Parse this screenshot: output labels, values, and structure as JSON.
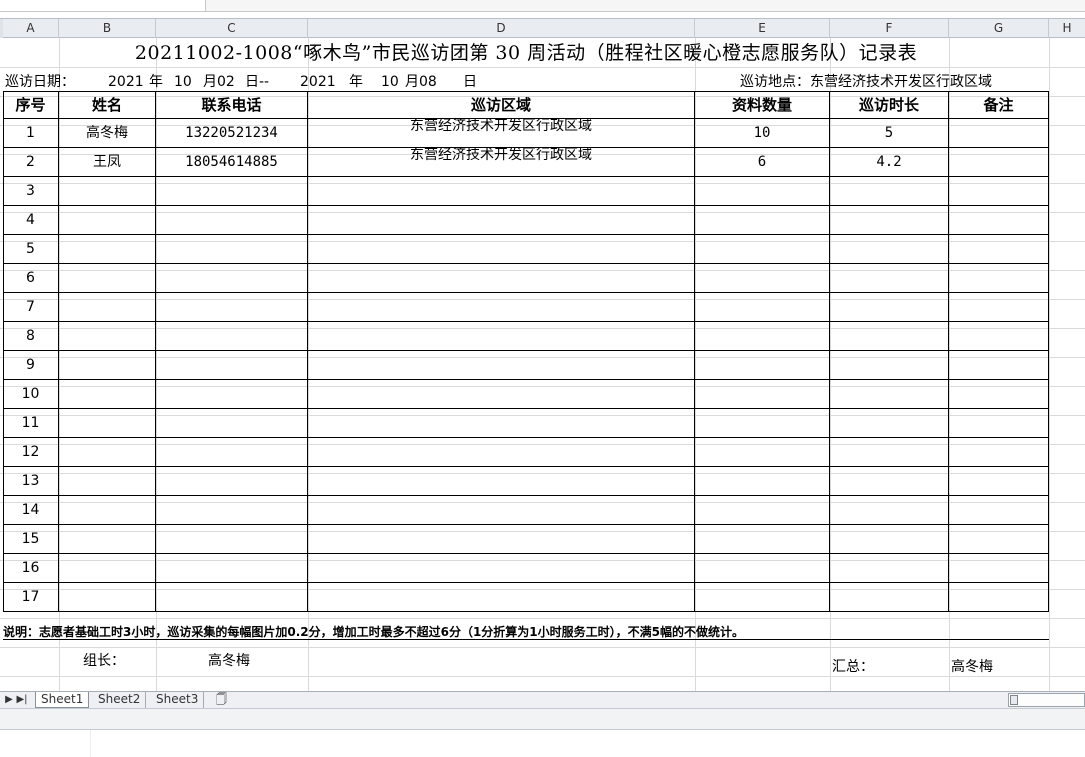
{
  "columns": [
    "A",
    "B",
    "C",
    "D",
    "E",
    "F",
    "G",
    "H"
  ],
  "title": "20211002-1008“啄木鸟”市民巡访团第 30 周活动（胜程社区暖心橙志愿服务队）记录表",
  "date_line": {
    "label": "巡访日期：",
    "start_year": "2021",
    "year_char": "年",
    "start_month": "10",
    "month_day_start": "月02",
    "day_char_sep": "日--",
    "end_year": "2021",
    "year_char2": "年",
    "end_month": "10",
    "month_day_end": "月08",
    "day_char": "日"
  },
  "location": "巡访地点：东营经济技术开发区行政区域",
  "headers": [
    "序号",
    "姓名",
    "联系电话",
    "巡访区域",
    "资料数量",
    "巡访时长",
    "备注"
  ],
  "rows": [
    {
      "seq": "1",
      "name": "高冬梅",
      "phone": "13220521234",
      "area": "东营经济技术开发区行政区域",
      "count": "10",
      "hours": "5",
      "note": ""
    },
    {
      "seq": "2",
      "name": "王凤",
      "phone": "18054614885",
      "area": "东营经济技术开发区行政区域",
      "count": "6",
      "hours": "4.2",
      "note": ""
    },
    {
      "seq": "3",
      "name": "",
      "phone": "",
      "area": "",
      "count": "",
      "hours": "",
      "note": ""
    },
    {
      "seq": "4",
      "name": "",
      "phone": "",
      "area": "",
      "count": "",
      "hours": "",
      "note": ""
    },
    {
      "seq": "5",
      "name": "",
      "phone": "",
      "area": "",
      "count": "",
      "hours": "",
      "note": ""
    },
    {
      "seq": "6",
      "name": "",
      "phone": "",
      "area": "",
      "count": "",
      "hours": "",
      "note": ""
    },
    {
      "seq": "7",
      "name": "",
      "phone": "",
      "area": "",
      "count": "",
      "hours": "",
      "note": ""
    },
    {
      "seq": "8",
      "name": "",
      "phone": "",
      "area": "",
      "count": "",
      "hours": "",
      "note": ""
    },
    {
      "seq": "9",
      "name": "",
      "phone": "",
      "area": "",
      "count": "",
      "hours": "",
      "note": ""
    },
    {
      "seq": "10",
      "name": "",
      "phone": "",
      "area": "",
      "count": "",
      "hours": "",
      "note": ""
    },
    {
      "seq": "11",
      "name": "",
      "phone": "",
      "area": "",
      "count": "",
      "hours": "",
      "note": ""
    },
    {
      "seq": "12",
      "name": "",
      "phone": "",
      "area": "",
      "count": "",
      "hours": "",
      "note": ""
    },
    {
      "seq": "13",
      "name": "",
      "phone": "",
      "area": "",
      "count": "",
      "hours": "",
      "note": ""
    },
    {
      "seq": "14",
      "name": "",
      "phone": "",
      "area": "",
      "count": "",
      "hours": "",
      "note": ""
    },
    {
      "seq": "15",
      "name": "",
      "phone": "",
      "area": "",
      "count": "",
      "hours": "",
      "note": ""
    },
    {
      "seq": "16",
      "name": "",
      "phone": "",
      "area": "",
      "count": "",
      "hours": "",
      "note": ""
    },
    {
      "seq": "17",
      "name": "",
      "phone": "",
      "area": "",
      "count": "",
      "hours": "",
      "note": ""
    }
  ],
  "note": "说明：志愿者基础工时3小时，巡访采集的每幅图片加0.2分，增加工时最多不超过6分（1分折算为1小时服务工时），不满5幅的不做统计。",
  "leader_label": "组长：",
  "leader_name": "高冬梅",
  "summary_label": "汇总：",
  "summary_name": "高冬梅",
  "tabs": [
    "Sheet1",
    "Sheet2",
    "Sheet3"
  ],
  "icons": {
    "nav_last": "last-sheet-icon",
    "nav_next": "next-sheet-icon",
    "new_sheet": "new-sheet-icon"
  }
}
